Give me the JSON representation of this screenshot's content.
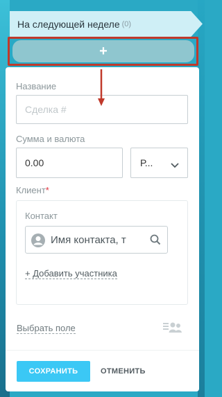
{
  "stage": {
    "title": "На следующей неделе",
    "count": "(0)"
  },
  "add_button": {
    "label": "+"
  },
  "form": {
    "title_label": "Название",
    "title_placeholder": "Сделка #",
    "title_value": "",
    "amount_label": "Сумма и валюта",
    "amount_value": "0.00",
    "currency_value": "Р...",
    "client_label": "Клиент",
    "client_required_mark": "*",
    "contact_label": "Контакт",
    "contact_placeholder": "Имя контакта, т",
    "add_member_label": "+ Добавить участника",
    "choose_field_label": "Выбрать поле",
    "save_label": "СОХРАНИТЬ",
    "cancel_label": "ОТМЕНИТЬ"
  },
  "icons": {
    "chevron": "chevron-down-icon",
    "avatar": "user-avatar-icon",
    "search": "search-icon",
    "people": "people-settings-icon"
  },
  "colors": {
    "accent": "#3bc8f5",
    "highlight": "#c0392b",
    "required": "#e0313d",
    "stage_bg": "#cfeff6",
    "add_button_bg": "#8fc6cf"
  }
}
